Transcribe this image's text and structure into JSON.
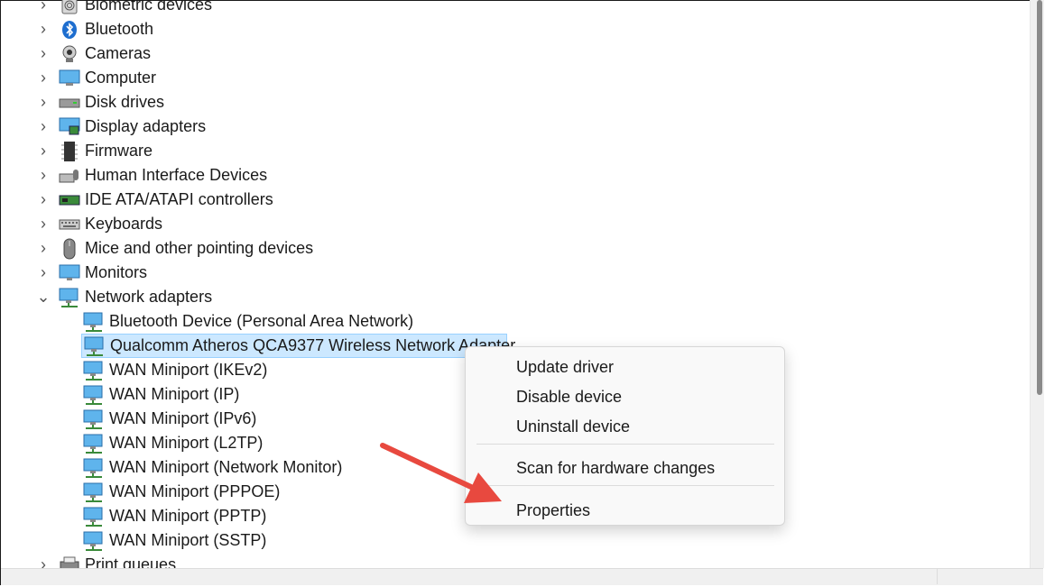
{
  "tree": {
    "categories": [
      {
        "label": "Biometric devices",
        "icon": "fingerprint-icon"
      },
      {
        "label": "Bluetooth",
        "icon": "bluetooth-icon"
      },
      {
        "label": "Cameras",
        "icon": "camera-icon"
      },
      {
        "label": "Computer",
        "icon": "computer-icon"
      },
      {
        "label": "Disk drives",
        "icon": "disk-drive-icon"
      },
      {
        "label": "Display adapters",
        "icon": "display-adapter-icon"
      },
      {
        "label": "Firmware",
        "icon": "firmware-chip-icon"
      },
      {
        "label": "Human Interface Devices",
        "icon": "hid-icon"
      },
      {
        "label": "IDE ATA/ATAPI controllers",
        "icon": "ide-controller-icon"
      },
      {
        "label": "Keyboards",
        "icon": "keyboard-icon"
      },
      {
        "label": "Mice and other pointing devices",
        "icon": "mouse-icon"
      },
      {
        "label": "Monitors",
        "icon": "monitor-icon"
      },
      {
        "label": "Network adapters",
        "icon": "network-adapter-icon",
        "expanded": true
      }
    ],
    "network_children": [
      "Bluetooth Device (Personal Area Network)",
      "Qualcomm Atheros QCA9377 Wireless Network Adapter",
      "WAN Miniport (IKEv2)",
      "WAN Miniport (IP)",
      "WAN Miniport (IPv6)",
      "WAN Miniport (L2TP)",
      "WAN Miniport (Network Monitor)",
      "WAN Miniport (PPPOE)",
      "WAN Miniport (PPTP)",
      "WAN Miniport (SSTP)"
    ],
    "selected_index": 1,
    "after_category": {
      "label": "Print queues",
      "icon": "printer-icon"
    }
  },
  "context_menu": {
    "update_driver": "Update driver",
    "disable_device": "Disable device",
    "uninstall_device": "Uninstall device",
    "scan_hardware": "Scan for hardware changes",
    "properties": "Properties"
  },
  "colors": {
    "selection_bg": "#cce8ff",
    "selection_border": "#99d1ff",
    "arrow": "#e8493f"
  }
}
